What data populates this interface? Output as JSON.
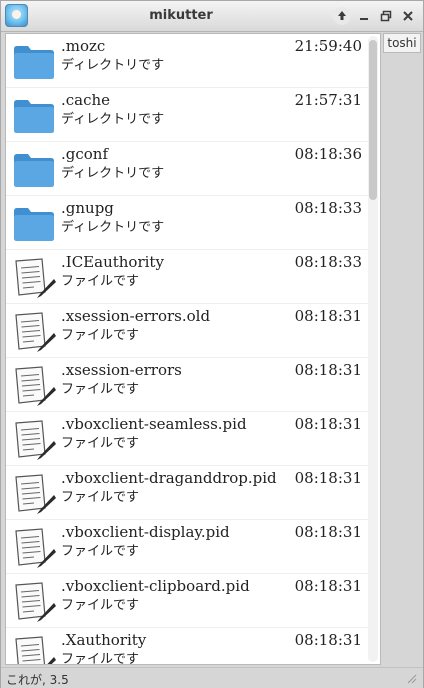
{
  "window": {
    "title": "mikutter"
  },
  "tab": {
    "label": "toshi"
  },
  "files": [
    {
      "name": ".mozc",
      "kind": "ディレクトリです",
      "time": "21:59:40",
      "icon": "folder-icon"
    },
    {
      "name": ".cache",
      "kind": "ディレクトリです",
      "time": "21:57:31",
      "icon": "folder-icon"
    },
    {
      "name": ".gconf",
      "kind": "ディレクトリです",
      "time": "08:18:36",
      "icon": "folder-icon"
    },
    {
      "name": ".gnupg",
      "kind": "ディレクトリです",
      "time": "08:18:33",
      "icon": "folder-icon"
    },
    {
      "name": ".ICEauthority",
      "kind": "ファイルです",
      "time": "08:18:33",
      "icon": "document-icon"
    },
    {
      "name": ".xsession-errors.old",
      "kind": "ファイルです",
      "time": "08:18:31",
      "icon": "document-icon"
    },
    {
      "name": ".xsession-errors",
      "kind": "ファイルです",
      "time": "08:18:31",
      "icon": "document-icon"
    },
    {
      "name": ".vboxclient-seamless.pid",
      "kind": "ファイルです",
      "time": "08:18:31",
      "icon": "document-icon"
    },
    {
      "name": ".vboxclient-draganddrop.pid",
      "kind": "ファイルです",
      "time": "08:18:31",
      "icon": "document-icon"
    },
    {
      "name": ".vboxclient-display.pid",
      "kind": "ファイルです",
      "time": "08:18:31",
      "icon": "document-icon"
    },
    {
      "name": ".vboxclient-clipboard.pid",
      "kind": "ファイルです",
      "time": "08:18:31",
      "icon": "document-icon"
    },
    {
      "name": ".Xauthority",
      "kind": "ファイルです",
      "time": "08:18:31",
      "icon": "document-icon"
    }
  ],
  "status": {
    "text": "これが, 3.5"
  },
  "colors": {
    "folder": "#4a9edb",
    "titlebar": "#e6e6e6"
  }
}
